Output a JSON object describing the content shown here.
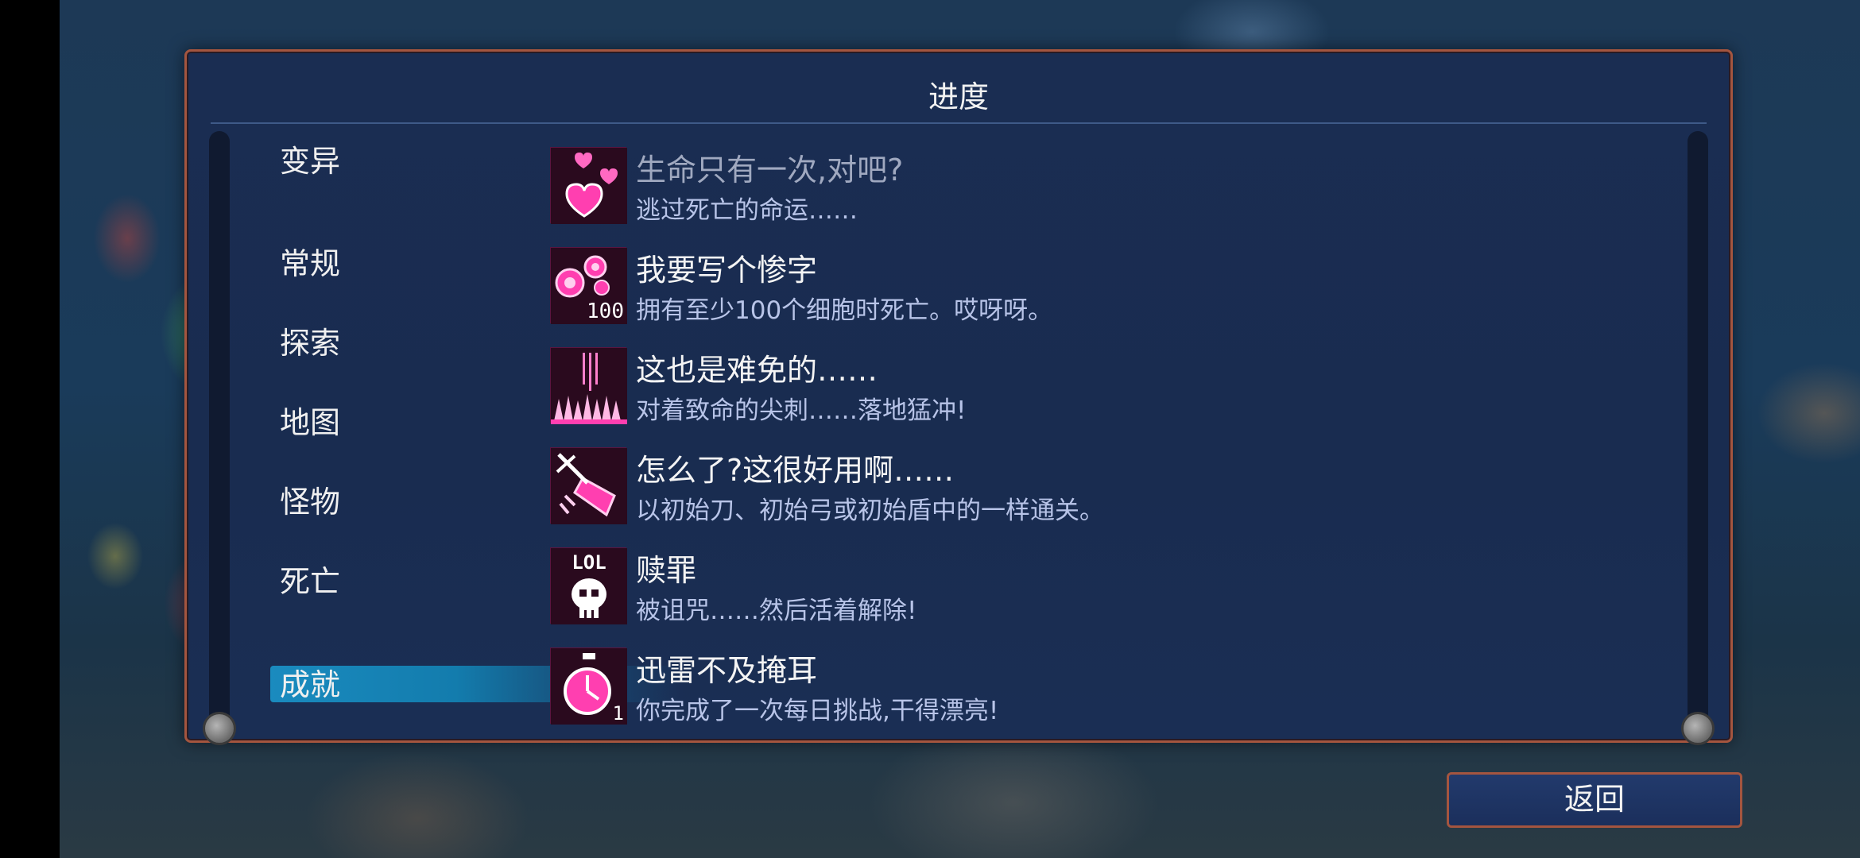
{
  "panel": {
    "title": "进度"
  },
  "categories": [
    {
      "label": "变异"
    },
    {
      "label": "常规"
    },
    {
      "label": "探索"
    },
    {
      "label": "地图"
    },
    {
      "label": "怪物"
    },
    {
      "label": "死亡"
    },
    {
      "label": "成就",
      "selected": true
    }
  ],
  "achievements": [
    {
      "title": "生命只有一次,对吧?",
      "desc": "逃过死亡的命运……",
      "icon": "hearts-icon",
      "dim": true
    },
    {
      "title": "我要写个惨字",
      "desc": "拥有至少100个细胞时死亡。哎呀呀。",
      "icon": "cells-100-icon",
      "icon_text": "100"
    },
    {
      "title": "这也是难免的……",
      "desc": "对着致命的尖刺……落地猛冲!",
      "icon": "spikes-icon"
    },
    {
      "title": "怎么了?这很好用啊……",
      "desc": "以初始刀、初始弓或初始盾中的一样通关。",
      "icon": "starter-weapon-icon"
    },
    {
      "title": "赎罪",
      "desc": "被诅咒……然后活着解除!",
      "icon": "lol-skull-icon",
      "icon_text": "LOL"
    },
    {
      "title": "迅雷不及掩耳",
      "desc": "你完成了一次每日挑战,干得漂亮!",
      "icon": "stopwatch-icon",
      "icon_text": "1"
    }
  ],
  "back_button": {
    "label": "返回"
  },
  "colors": {
    "panel_border": "#a4553f",
    "selected_tab": "#1a8bbf",
    "icon_magenta": "#ff2fa8"
  }
}
